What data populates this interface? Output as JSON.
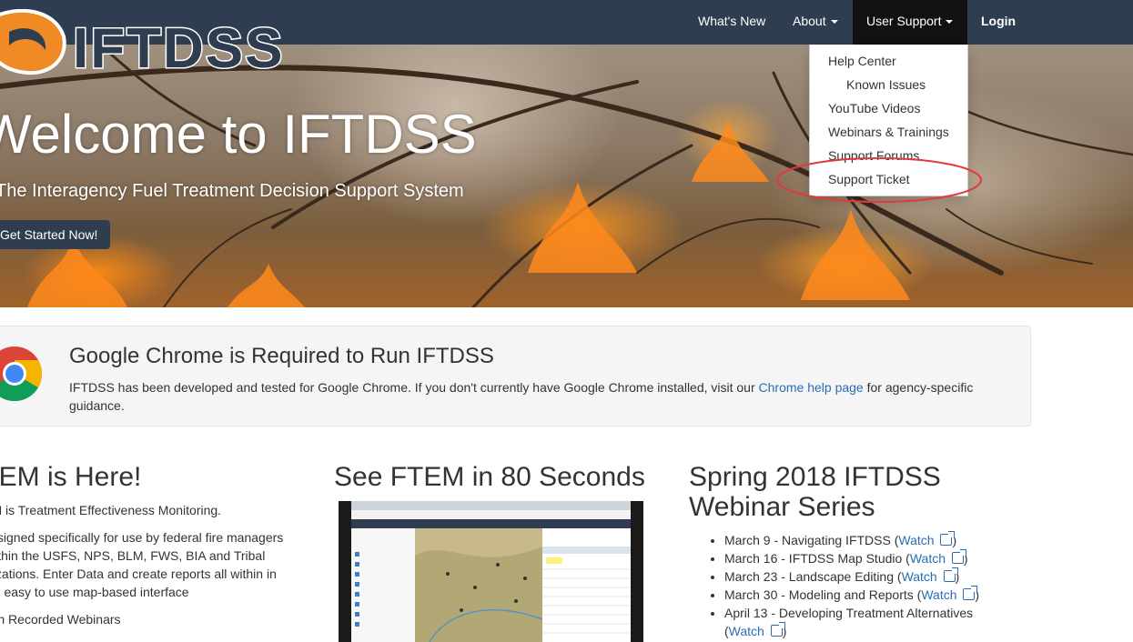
{
  "nav": {
    "logo_text": "IFTDSS",
    "whats_new": "What's New",
    "about": "About",
    "user_support": "User Support",
    "login": "Login"
  },
  "dropdown": {
    "items": [
      {
        "label": "Help Center"
      },
      {
        "label": "Known Issues"
      },
      {
        "label": "YouTube Videos"
      },
      {
        "label": "Webinars & Trainings"
      },
      {
        "label": "Support Forums"
      },
      {
        "label": "Support Ticket"
      }
    ]
  },
  "hero": {
    "title": "Welcome to IFTDSS",
    "subtitle": "The Interagency Fuel Treatment Decision Support System",
    "button": "Get Started Now!"
  },
  "chrome": {
    "title": "Google Chrome is Required to Run IFTDSS",
    "text_before": "IFTDSS has been developed and tested for Google Chrome. If you don't currently have Google Chrome installed, visit our ",
    "link": "Chrome help page",
    "text_after": " for agency-specific guidance."
  },
  "ftem": {
    "heading": "FTEM is Here!",
    "line1": "FTEM is Treatment Effectiveness Monitoring.",
    "para": [
      "Designed specifically for use by federal fire managers",
      "within the USFS, NPS, BLM, FWS, BIA and Tribal",
      "organizations. Enter Data and create reports all within in",
      "an easy to use map-based interface"
    ],
    "link": "Watch Recorded Webinars"
  },
  "video": {
    "heading": "See FTEM in 80 Seconds"
  },
  "webinar_series": {
    "heading_line1": "Spring 2018 IFTDSS",
    "heading_line2": "Webinar Series",
    "watch_label": "Watch",
    "items": [
      {
        "text": "March 9 - Navigating IFTDSS"
      },
      {
        "text": "March 16 - IFTDSS Map Studio"
      },
      {
        "text": "March 23 - Landscape Editing"
      },
      {
        "text": "March 30 - Modeling and Reports"
      },
      {
        "text": "April 13 - Developing Treatment Alternatives"
      }
    ]
  },
  "colors": {
    "navbar": "#2e3d4f",
    "link": "#2a6db5",
    "highlight": "#e0393e"
  }
}
